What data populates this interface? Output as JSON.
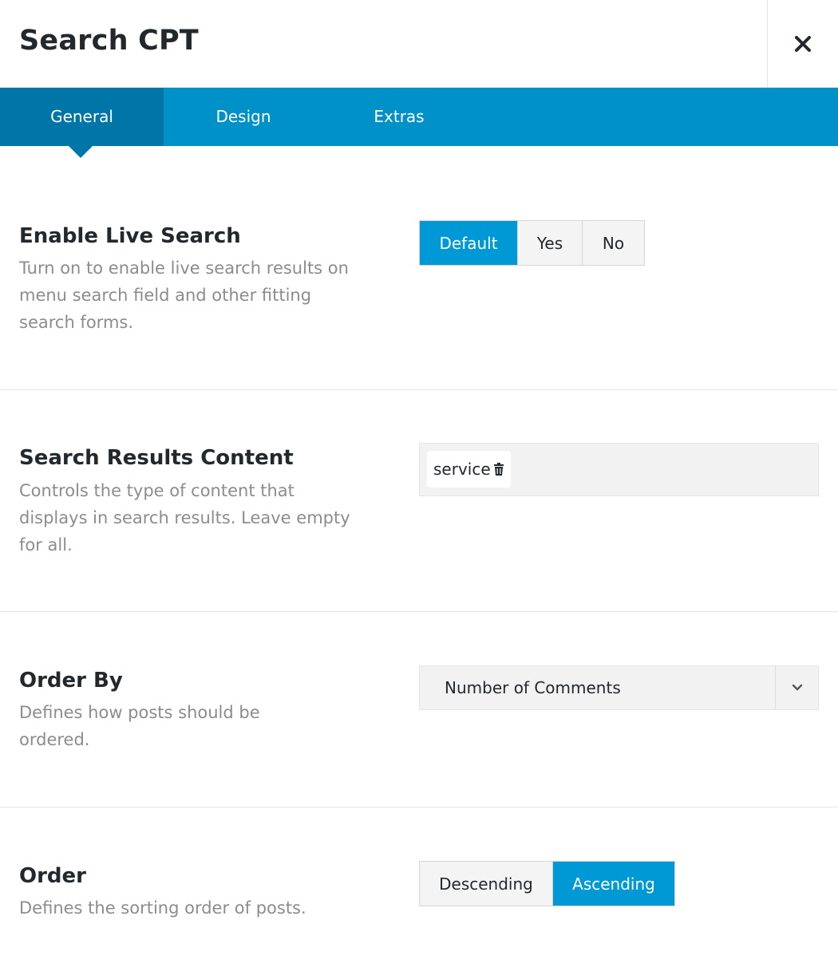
{
  "header": {
    "title": "Search CPT",
    "close_icon": "close-icon"
  },
  "tabs": [
    {
      "label": "General",
      "active": true
    },
    {
      "label": "Design",
      "active": false
    },
    {
      "label": "Extras",
      "active": false
    }
  ],
  "colors": {
    "tab_bar": "#0091c8",
    "tab_active": "#0075a7",
    "button_selected": "#0099d5",
    "description_text": "#8c8c8c"
  },
  "settings": {
    "live_search": {
      "label": "Enable Live Search",
      "description": "Turn on to enable live search results on menu search field and other fitting search forms.",
      "options": [
        "Default",
        "Yes",
        "No"
      ],
      "selected": "Default"
    },
    "results_content": {
      "label": "Search Results Content",
      "description": "Controls the type of content that displays in search results. Leave empty for all.",
      "tags": [
        {
          "label": "service",
          "remove_icon": "trash-icon"
        }
      ]
    },
    "order_by": {
      "label": "Order By",
      "description": "Defines how posts should be ordered.",
      "selected_value": "Number of Comments",
      "dropdown_icon": "chevron-down-icon"
    },
    "order": {
      "label": "Order",
      "description": "Defines the sorting order of posts.",
      "options": [
        "Descending",
        "Ascending"
      ],
      "selected": "Ascending"
    }
  }
}
